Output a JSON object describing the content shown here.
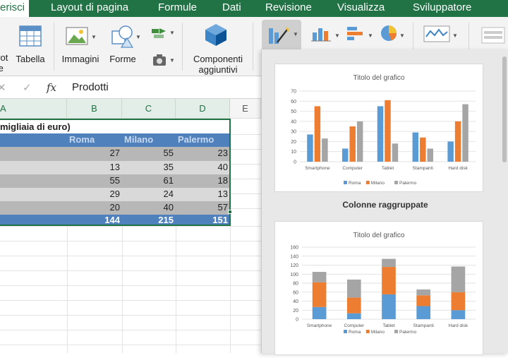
{
  "ribbon_tabs": [
    "erisci",
    "Layout di pagina",
    "Formule",
    "Dati",
    "Revisione",
    "Visualizza",
    "Sviluppatore"
  ],
  "ribbon_buttons": {
    "pivot": "vot\nte",
    "tabella": "Tabella",
    "immagini": "Immagini",
    "forme": "Forme",
    "componenti": "Componenti\naggiuntivi"
  },
  "formula_bar": {
    "cancel": "✕",
    "confirm": "✓",
    "fx": "fx",
    "value": "Prodotti"
  },
  "sheet": {
    "columns": [
      "A",
      "B",
      "C",
      "D",
      "E"
    ],
    "title_cell": "migliaia di euro)",
    "headers": [
      "Roma",
      "Milano",
      "Palermo"
    ],
    "rows": [
      [
        27,
        55,
        23
      ],
      [
        13,
        35,
        40
      ],
      [
        55,
        61,
        18
      ],
      [
        29,
        24,
        13
      ],
      [
        20,
        40,
        57
      ]
    ],
    "totals": [
      144,
      215,
      151
    ]
  },
  "gallery": {
    "section_label": "Colonne raggruppate"
  },
  "chart_data": [
    {
      "type": "bar",
      "title": "Titolo del grafico",
      "categories": [
        "Smartphone",
        "Computer",
        "Tablet",
        "Stampanti",
        "Hard disk"
      ],
      "series": [
        {
          "name": "Roma",
          "values": [
            27,
            13,
            55,
            29,
            20
          ],
          "color": "#5b9bd5"
        },
        {
          "name": "Milano",
          "values": [
            55,
            35,
            61,
            24,
            40
          ],
          "color": "#ed7d31"
        },
        {
          "name": "Palermo",
          "values": [
            23,
            40,
            18,
            13,
            57
          ],
          "color": "#a5a5a5"
        }
      ],
      "ylim": [
        0,
        70
      ],
      "yticks": [
        0,
        10,
        20,
        30,
        40,
        50,
        60,
        70
      ],
      "grid": true,
      "legend": "bottom"
    },
    {
      "type": "bar",
      "stacked": true,
      "title": "Titolo del grafico",
      "categories": [
        "Smartphone",
        "Computer",
        "Tablet",
        "Stampanti",
        "Hard disk"
      ],
      "series": [
        {
          "name": "Roma",
          "values": [
            27,
            13,
            55,
            29,
            20
          ],
          "color": "#5b9bd5"
        },
        {
          "name": "Milano",
          "values": [
            55,
            35,
            61,
            24,
            40
          ],
          "color": "#ed7d31"
        },
        {
          "name": "Palermo",
          "values": [
            23,
            40,
            18,
            13,
            57
          ],
          "color": "#a5a5a5"
        }
      ],
      "ylim": [
        0,
        160
      ],
      "yticks": [
        0,
        20,
        40,
        60,
        80,
        100,
        120,
        140,
        160
      ],
      "grid": true,
      "legend": "bottom"
    }
  ]
}
